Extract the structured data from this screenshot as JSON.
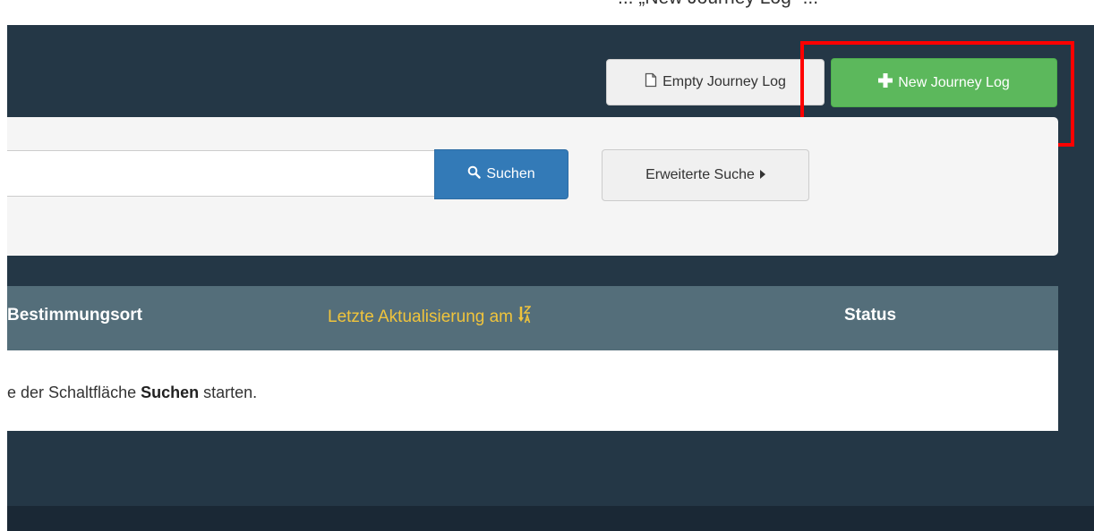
{
  "top_note": "... „New Journey Log“ ...",
  "toolbar": {
    "empty_label": "Empty Journey Log",
    "new_label": "New Journey Log",
    "empty_icon": "document-icon",
    "new_icon": "plus-icon"
  },
  "search": {
    "value": "",
    "button_label": "Suchen",
    "button_icon": "search-icon",
    "advanced_label": "Erweiterte Suche",
    "advanced_icon": "caret-right-icon"
  },
  "table": {
    "columns": [
      "Bestimmungsort",
      "Letzte Aktualisierung am",
      "Status"
    ],
    "sort_icon": "sort-alpha-desc-icon",
    "empty_hint_prefix": "e der Schaltfläche",
    "empty_hint_bold": "Suchen",
    "empty_hint_suffix": "starten."
  },
  "colors": {
    "highlight": "#ff0000",
    "primary": "#337ab7",
    "success": "#5cb85c",
    "sorted_header": "#f0c43c"
  }
}
